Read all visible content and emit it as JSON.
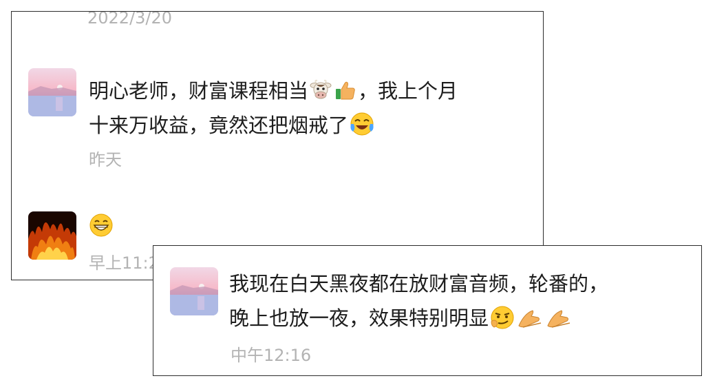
{
  "chat_a": {
    "date_stamp": "2022/3/20",
    "message_1": {
      "line_1_before_emoji": "明心老师，财富课程相当",
      "line_1_emoji_1": "cow-face-icon",
      "line_1_emoji_2": "thumbs-up-icon",
      "line_1_after_emoji": "，我上个月",
      "line_2": "十来万收益，竟然还把烟戒了",
      "line_2_emoji": "laughing-crying-icon",
      "time": "昨天"
    },
    "message_2": {
      "emoji": "grinning-face-icon",
      "time": "早上11:2"
    }
  },
  "chat_b": {
    "message": {
      "line_1": "我现在白天黑夜都在放财富音频，轮番的，",
      "line_2": "晚上也放一夜，效果特别明显",
      "line_2_emojis": [
        "smirk-face-icon",
        "clap-hands-icon",
        "clap-hands-icon"
      ],
      "time": "中午12:16"
    }
  },
  "colors": {
    "text": "#1d1d1d",
    "timestamp": "#b3b3b3",
    "border": "#2b2b2b"
  }
}
